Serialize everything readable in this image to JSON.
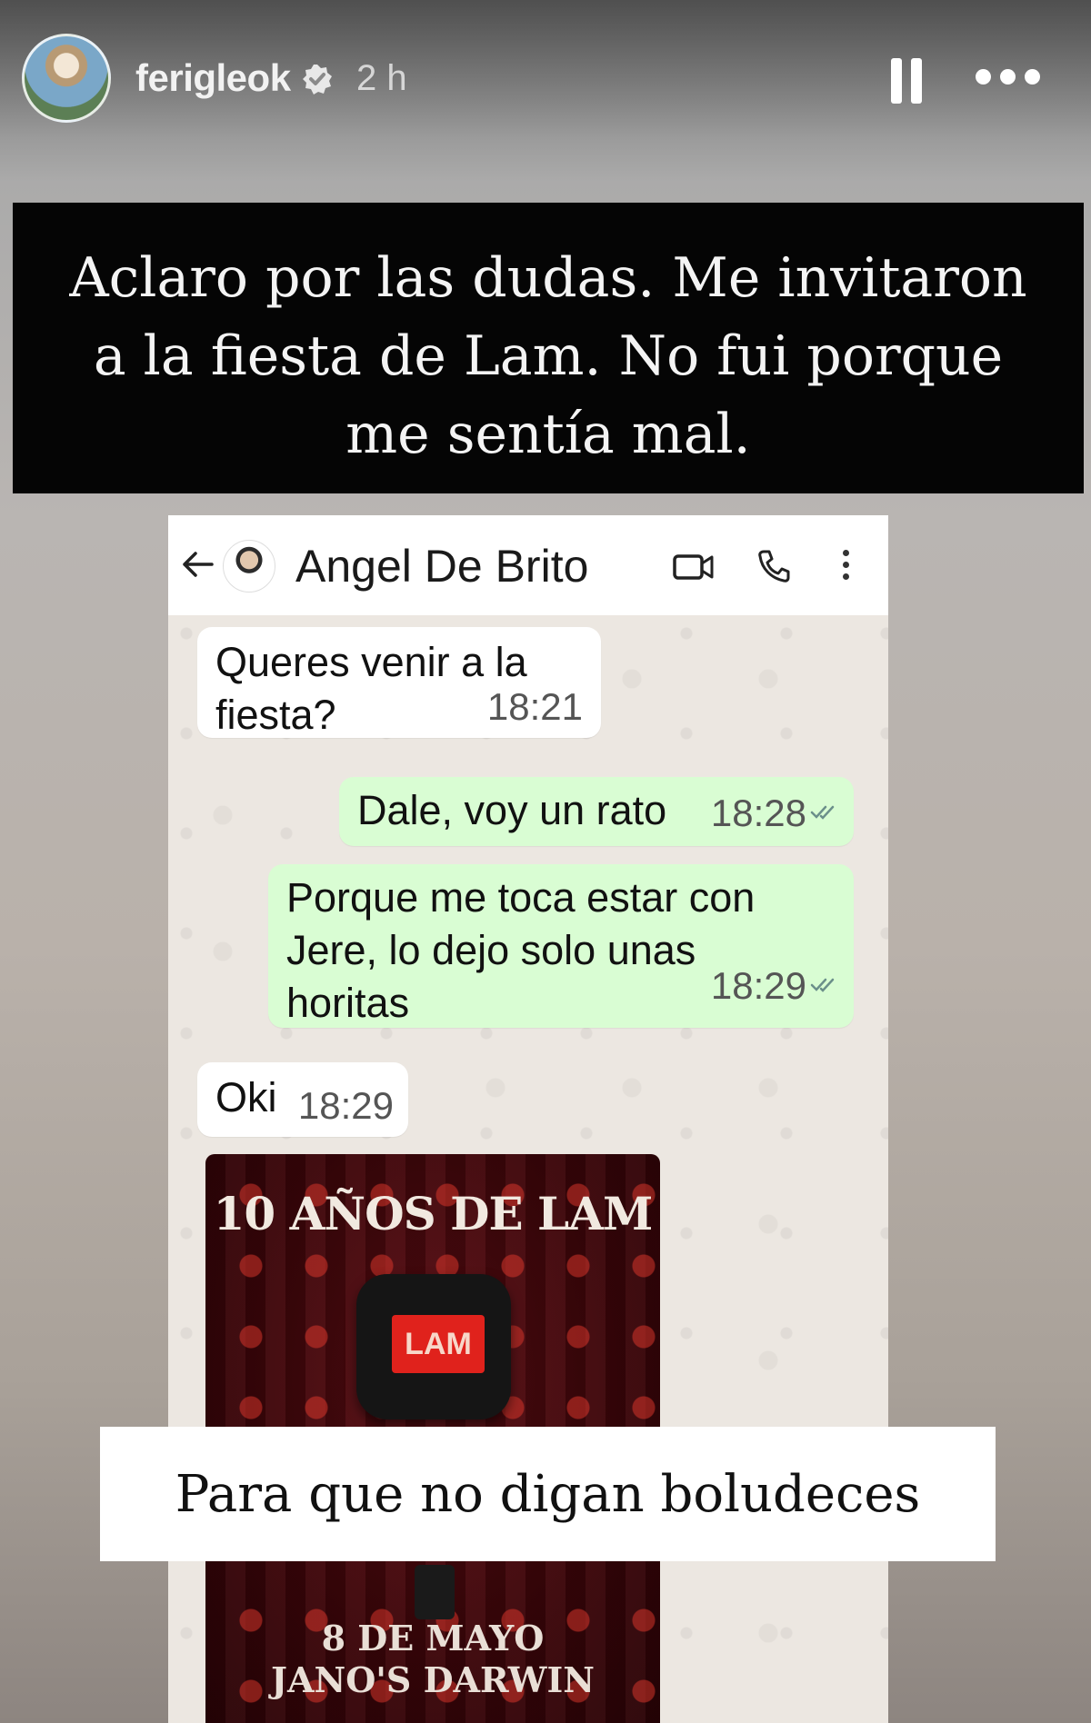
{
  "story_header": {
    "username": "ferigleok",
    "time_ago": "2 h",
    "icons": {
      "verified": "verified-badge-icon",
      "pause": "pause-icon",
      "more": "more-options-icon"
    }
  },
  "captions": {
    "top_text": "Aclaro por las dudas. Me invitaron a la fiesta de Lam. No fui porque me sentía mal.",
    "bottom_text": "Para que no digan boludeces"
  },
  "chat": {
    "contact_name": "Angel De Brito",
    "icons": {
      "back": "back-arrow-icon",
      "video": "video-call-icon",
      "call": "phone-icon",
      "menu": "menu-dots-icon"
    },
    "messages": [
      {
        "direction": "in",
        "text": "Queres venir a la fiesta?",
        "time": "18:21"
      },
      {
        "direction": "out",
        "text": "Dale, voy un rato",
        "time": "18:28"
      },
      {
        "direction": "out",
        "text": "Porque me toca estar con Jere, lo dejo solo unas horitas",
        "time": "18:29"
      },
      {
        "direction": "in",
        "text": "Oki",
        "time": "18:29"
      }
    ],
    "poster": {
      "title": "10 AÑOS DE LAM",
      "mic_label": "LAM",
      "date_line1": "8 DE MAYO",
      "date_line2": "JANO'S DARWIN"
    }
  },
  "colors": {
    "incoming_bubble": "#ffffff",
    "outgoing_bubble": "#d9fdd3",
    "caption_black": "#050505",
    "poster_red": "#5a0c12"
  }
}
